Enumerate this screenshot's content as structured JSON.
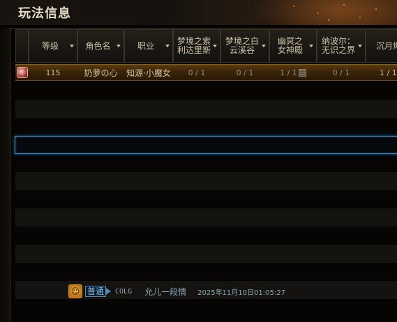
{
  "window": {
    "title": "玩法信息"
  },
  "table": {
    "columns": [
      {
        "key": "icon",
        "label": ""
      },
      {
        "key": "level",
        "label": "等级"
      },
      {
        "key": "name",
        "label": "角色名"
      },
      {
        "key": "job",
        "label": "职业"
      },
      {
        "key": "dungeon1",
        "label": "梦境之索利达里斯"
      },
      {
        "key": "dungeon2",
        "label": "梦境之白云溪谷"
      },
      {
        "key": "dungeon3",
        "label": "幽冥之女神殿"
      },
      {
        "key": "dungeon4",
        "label": "纳波尔：无识之界"
      },
      {
        "key": "dungeon5",
        "label": "沉月烬"
      }
    ],
    "rows": [
      {
        "level": "115",
        "name": "奶萝の心",
        "job": "知源·小魔女",
        "dungeon1": "0 / 1",
        "dungeon2": "0 / 1",
        "dungeon3": "1 / 1",
        "dungeon4": "0 / 1",
        "dungeon5": "1 / 1"
      }
    ]
  },
  "chat": {
    "channel": "普通",
    "guild": "COLG",
    "user": "允儿一段情",
    "time": "2025年11月10日01:05:27"
  },
  "colors": {
    "selected_row": "#5a3a12",
    "focus_border": "#3a8ac0",
    "channel": "#7ac0e8"
  }
}
